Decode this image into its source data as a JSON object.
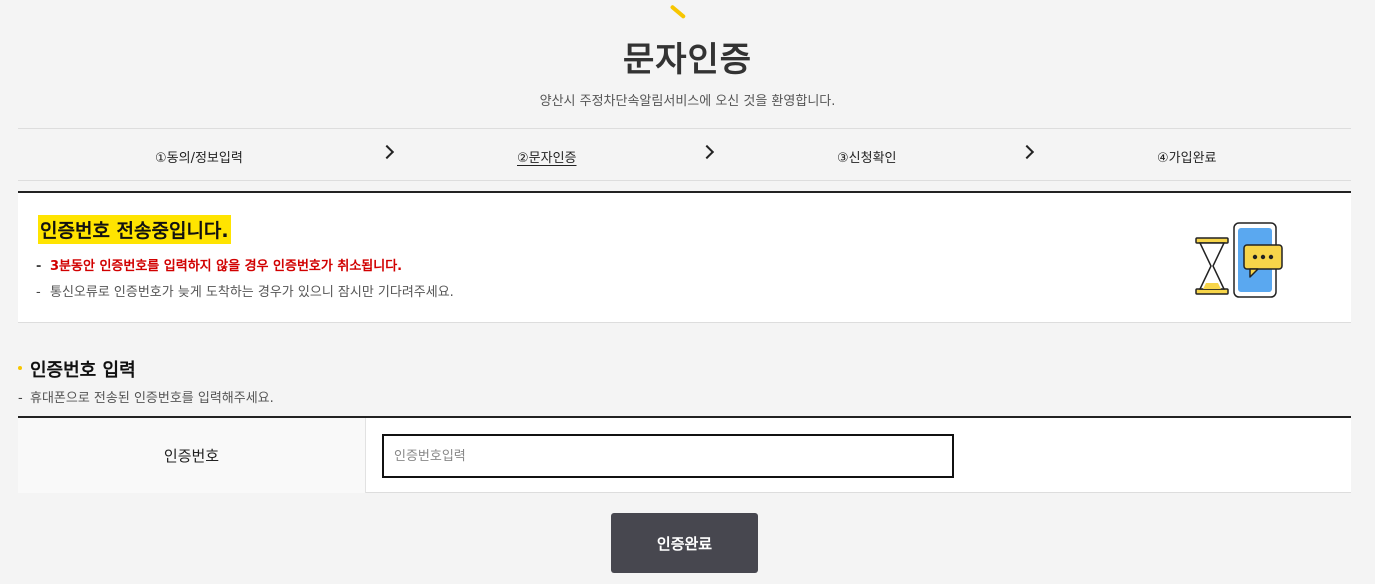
{
  "header": {
    "title": "문자인증",
    "subtitle": "양산시 주정차단속알림서비스에 오신 것을 환영합니다."
  },
  "steps": [
    {
      "label": "①동의/정보입력",
      "active": false
    },
    {
      "label": "②문자인증",
      "active": true
    },
    {
      "label": "③신청확인",
      "active": false
    },
    {
      "label": "④가입완료",
      "active": false
    }
  ],
  "notice": {
    "title": "인증번호 전송중입니다.",
    "warning": "3분동안 인증번호를 입력하지 않을 경우 인증번호가 취소됩니다.",
    "info": "통신오류로 인증번호가 늦게 도착하는 경우가 있으니 잠시만 기다려주세요.",
    "dash": "-"
  },
  "section": {
    "title": "인증번호 입력",
    "description": "휴대폰으로 전송된 인증번호를 입력해주세요.",
    "dash": "-"
  },
  "form": {
    "code_label": "인증번호",
    "code_placeholder": "인증번호입력",
    "code_value": ""
  },
  "actions": {
    "submit_label": "인증완료"
  },
  "colors": {
    "accent_yellow": "#ffe400",
    "warning_red": "#d10000",
    "button_bg": "#47474f"
  },
  "icons": {
    "step_separator": "chevron-right-icon",
    "illustration": "hourglass-phone-message-illustration"
  }
}
